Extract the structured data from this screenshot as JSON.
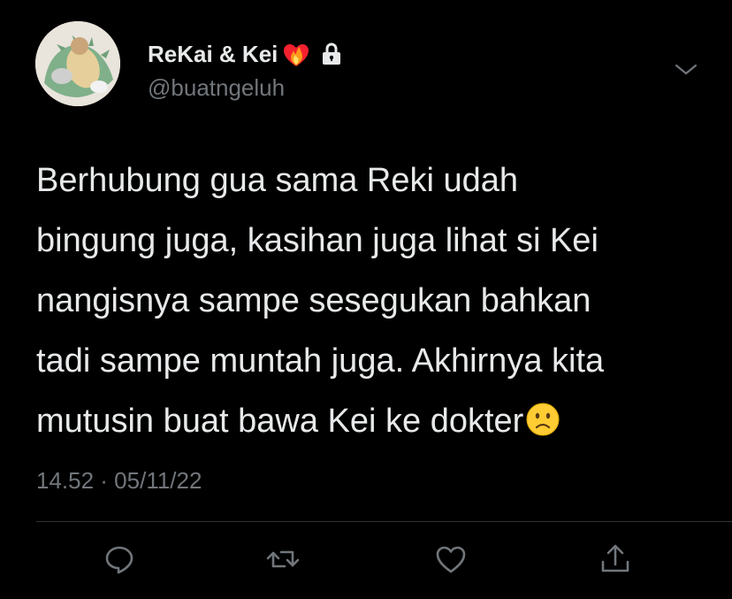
{
  "tweet": {
    "display_name": "ReKai & Kei",
    "handle": "@buatngeluh",
    "lines": [
      "Berhubung gua sama Reki udah",
      "bingung juga, kasihan juga lihat si Kei",
      "nangisnya sampe sesegukan bahkan",
      "tadi sampe muntah juga. Akhirnya kita",
      "mutusin buat bawa Kei ke dokter"
    ],
    "timestamp": "14.52 · 05/11/22"
  },
  "icons": {
    "name_emoji": "heart-on-fire-icon",
    "protected": "lock-icon",
    "more": "chevron-down-icon",
    "trailing_emoji": "slightly-frowning-face-icon",
    "actions": [
      "reply-icon",
      "retweet-icon",
      "like-icon",
      "share-icon"
    ]
  },
  "colors": {
    "background": "#000000",
    "primary_text": "#e7e9ea",
    "secondary_text": "#71767b",
    "divider": "#2f3336",
    "heart": "#f5212e",
    "flame": "#ff9a1a",
    "emoji_face": "#ffcc33"
  }
}
